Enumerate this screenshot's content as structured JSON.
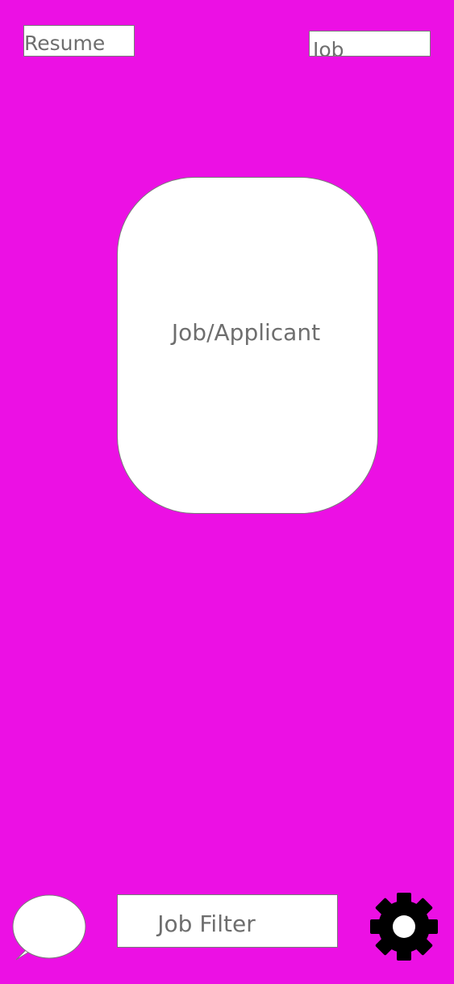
{
  "top_bar": {
    "resume_label": "Resume",
    "job_label": "Job"
  },
  "card": {
    "label": "Job/Applicant"
  },
  "bottom_bar": {
    "chat_icon": "speech-bubble-icon",
    "filter_label": "Job Filter",
    "settings_icon": "gear-icon"
  },
  "colors": {
    "background": "#ec10e4",
    "surface": "#ffffff",
    "text": "#6e6e6e",
    "border": "#7a7a7a",
    "icon": "#000000"
  }
}
